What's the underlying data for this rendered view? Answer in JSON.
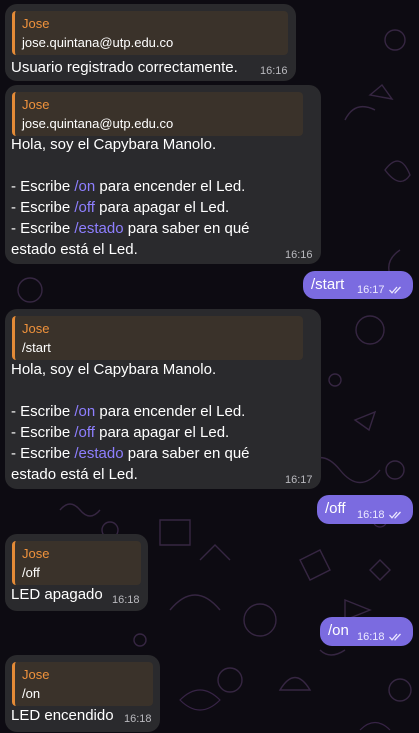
{
  "colors": {
    "incoming_bubble": "#2a2a2d",
    "outgoing_bubble": "#7b6be0",
    "reply_accent": "#e38a37",
    "reply_name": "#f0923c",
    "command_link": "#8e7fff"
  },
  "messages": [
    {
      "reply": {
        "name": "Jose",
        "text": "jose.quintana@utp.edu.co"
      },
      "text": "Usuario registrado correctamente.",
      "time": "16:16"
    },
    {
      "reply": {
        "name": "Jose",
        "text": "jose.quintana@utp.edu.co"
      },
      "greeting": "Hola, soy el Capybara Manolo.",
      "instructions": [
        {
          "prefix": "- Escribe ",
          "command": "/on",
          "suffix": " para encender el Led."
        },
        {
          "prefix": "- Escribe ",
          "command": "/off",
          "suffix": " para apagar el Led."
        },
        {
          "prefix": "- Escribe ",
          "command": "/estado",
          "suffix": " para saber en qué"
        }
      ],
      "last_line": "estado está el Led.",
      "time": "16:16"
    },
    {
      "text": "/start",
      "time": "16:17",
      "status": "read-double-check"
    },
    {
      "reply": {
        "name": "Jose",
        "text": "/start"
      },
      "greeting": "Hola, soy el Capybara Manolo.",
      "instructions": [
        {
          "prefix": "- Escribe ",
          "command": "/on",
          "suffix": " para encender el Led."
        },
        {
          "prefix": "- Escribe ",
          "command": "/off",
          "suffix": " para apagar el Led."
        },
        {
          "prefix": "- Escribe ",
          "command": "/estado",
          "suffix": " para saber en qué"
        }
      ],
      "last_line": "estado está el Led.",
      "time": "16:17"
    },
    {
      "text": "/off",
      "time": "16:18",
      "status": "read-double-check"
    },
    {
      "reply": {
        "name": "Jose",
        "text": "/off"
      },
      "text": "LED apagado",
      "time": "16:18"
    },
    {
      "text": "/on",
      "time": "16:18",
      "status": "read-double-check"
    },
    {
      "reply": {
        "name": "Jose",
        "text": "/on"
      },
      "text": "LED encendido",
      "time": "16:18"
    }
  ]
}
